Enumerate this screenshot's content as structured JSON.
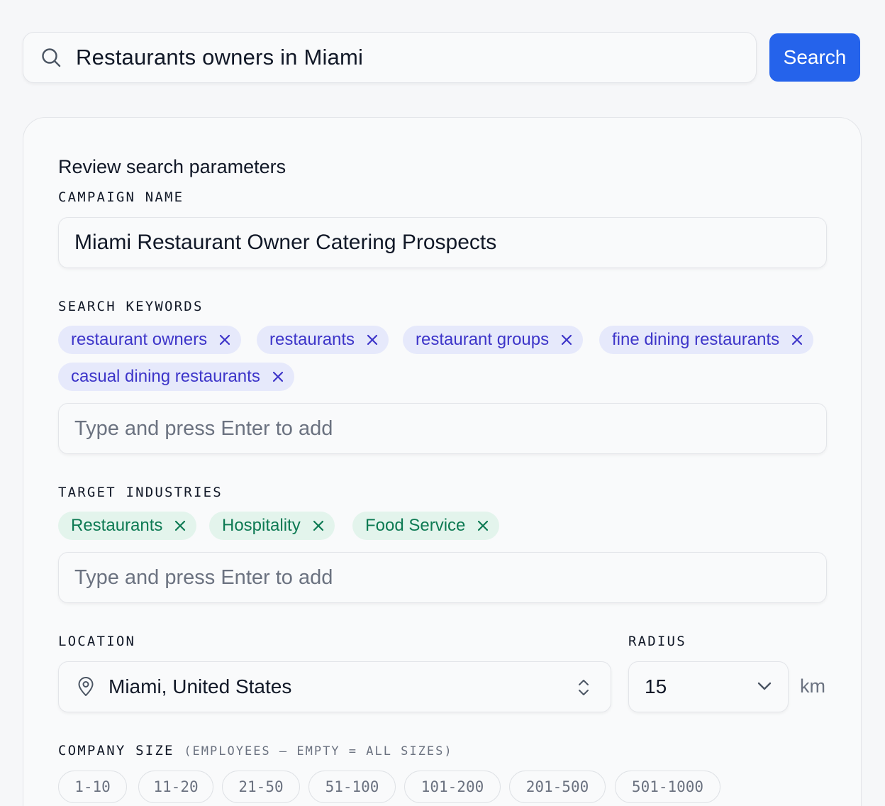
{
  "search": {
    "query": "Restaurants owners in Miami",
    "button_label": "Search"
  },
  "card": {
    "title": "Review search parameters",
    "campaign": {
      "label": "CAMPAIGN NAME",
      "value": "Miami Restaurant Owner Catering Prospects"
    },
    "keywords": {
      "label": "SEARCH KEYWORDS",
      "chips": [
        "restaurant owners",
        "restaurants",
        "restaurant groups",
        "fine dining restaurants",
        "casual dining restaurants"
      ],
      "placeholder": "Type and press Enter to add"
    },
    "industries": {
      "label": "TARGET INDUSTRIES",
      "chips": [
        "Restaurants",
        "Hospitality",
        "Food Service"
      ],
      "placeholder": "Type and press Enter to add"
    },
    "location": {
      "label": "LOCATION",
      "value": "Miami, United States"
    },
    "radius": {
      "label": "RADIUS",
      "value": "15",
      "unit": "km"
    },
    "company_size": {
      "label": "COMPANY SIZE",
      "hint": "(EMPLOYEES — EMPTY = ALL SIZES)",
      "options": [
        "1-10",
        "11-20",
        "21-50",
        "51-100",
        "101-200",
        "201-500",
        "501-1000"
      ]
    }
  },
  "colors": {
    "accent": "#2563eb",
    "keyword_chip_bg": "#e6e9fb",
    "keyword_chip_text": "#3d35c9",
    "industry_chip_bg": "#e3f4ec",
    "industry_chip_text": "#0d7a53"
  },
  "icons": {
    "search": "search-icon",
    "chip_remove": "close-icon",
    "location": "map-pin-icon",
    "location_select": "chevron-up-down-icon",
    "radius_select": "chevron-down-icon"
  }
}
